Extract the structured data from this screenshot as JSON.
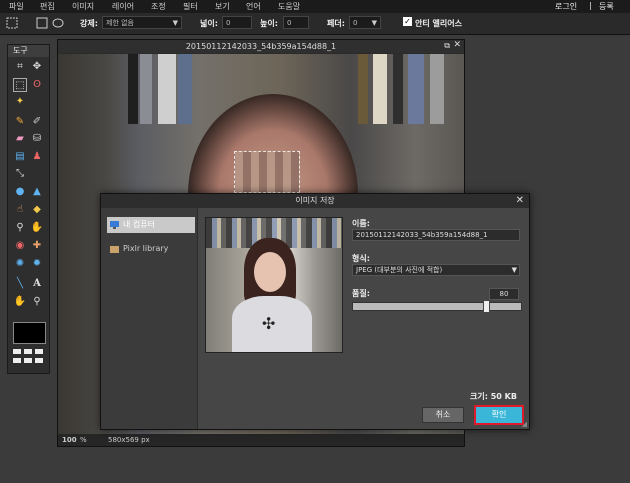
{
  "menu": {
    "items": [
      "파일",
      "편집",
      "이미지",
      "레이어",
      "조정",
      "필터",
      "보기",
      "언어",
      "도움말"
    ],
    "login": "로그인",
    "divider": "|",
    "register": "등록"
  },
  "options": {
    "style_label": "강제:",
    "style_value": "제한 없음",
    "width_label": "넓이:",
    "width_value": "0",
    "height_label": "높이:",
    "height_value": "0",
    "feather_label": "페더:",
    "feather_value": "0",
    "antialias_label": "안티 앨리어스",
    "antialias_checked": true
  },
  "tools": {
    "header": "도구",
    "icons": [
      "crop-icon",
      "move-icon",
      "marquee-icon",
      "lasso-icon",
      "wand-icon",
      "pencil-icon",
      "brush-icon",
      "eraser-icon",
      "bucket-icon",
      "gradient-icon",
      "stamp-icon",
      "picker-icon",
      "drop-icon",
      "finger-icon",
      "sponge-icon",
      "dodge-icon",
      "burn-icon",
      "redeye-icon",
      "spot-heal-icon",
      "bloat-icon",
      "pinch-icon",
      "line-icon",
      "text-icon",
      "hand-icon",
      "zoom-icon"
    ],
    "primary_color": "#000000"
  },
  "document": {
    "title": "20150112142033_54b359a154d88_1",
    "zoom": "100",
    "zoom_unit": "%",
    "dimensions": "580x569 px"
  },
  "dialog": {
    "title": "이미지 저장",
    "sidebar": [
      {
        "label": "내 컴퓨터",
        "active": true
      },
      {
        "label": "Pixlr library",
        "active": false
      }
    ],
    "name_label": "이름:",
    "name_value": "20150112142033_54b359a154d88_1",
    "format_label": "형식:",
    "format_value": "JPEG (대부분의 사진에 적합)",
    "quality_label": "품질:",
    "quality_value": "80",
    "quality_fraction": 0.8,
    "size_text": "크기: 50 KB",
    "cancel_label": "취소",
    "ok_label": "확인"
  },
  "colors": {
    "ok_button": "#3ab7d8",
    "highlight": "#e0192b"
  }
}
